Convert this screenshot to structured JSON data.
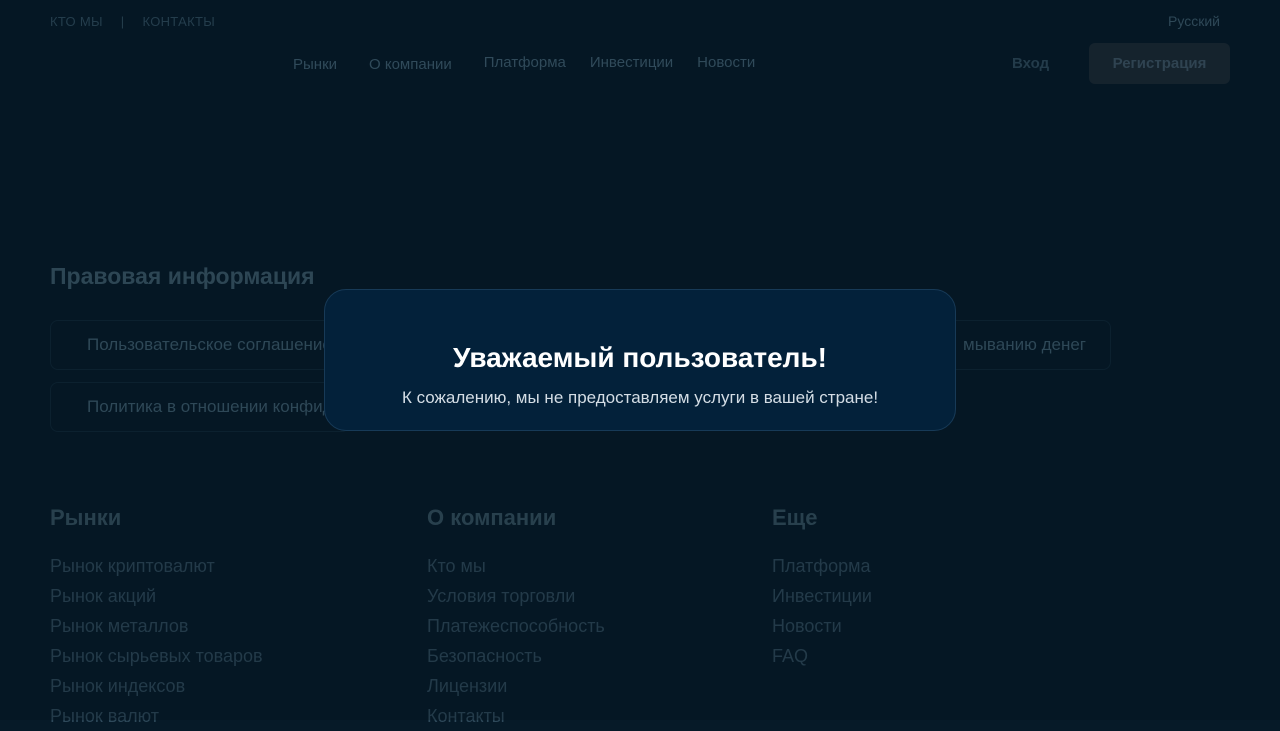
{
  "topbar": {
    "about": "КТО МЫ",
    "separator": "|",
    "contacts": "КОНТАКТЫ"
  },
  "language": "Русский",
  "nav": {
    "items": [
      "Рынки",
      "О компании",
      "Платформа",
      "Инвестиции",
      "Новости"
    ],
    "login": "Вход",
    "register": "Регистрация"
  },
  "legal": {
    "title": "Правовая информация",
    "items": [
      "Пользовательское соглашение",
      "Политика в отношении конфиденциальности",
      "мыванию денег"
    ]
  },
  "footer": {
    "columns": [
      {
        "title": "Рынки",
        "links": [
          "Рынок криптовалют",
          "Рынок акций",
          "Рынок металлов",
          "Рынок сырьевых товаров",
          "Рынок индексов",
          "Рынок валют"
        ]
      },
      {
        "title": "О компании",
        "links": [
          "Кто мы",
          "Условия торговли",
          "Платежеспособность",
          "Безопасность",
          "Лицензии",
          "Контакты"
        ]
      },
      {
        "title": "Еще",
        "links": [
          "Платформа",
          "Инвестиции",
          "Новости",
          "FAQ"
        ]
      }
    ]
  },
  "modal": {
    "title": "Уважаемый пользователь!",
    "message": "К сожалению, мы не предоставляем услуги в вашей стране!"
  }
}
